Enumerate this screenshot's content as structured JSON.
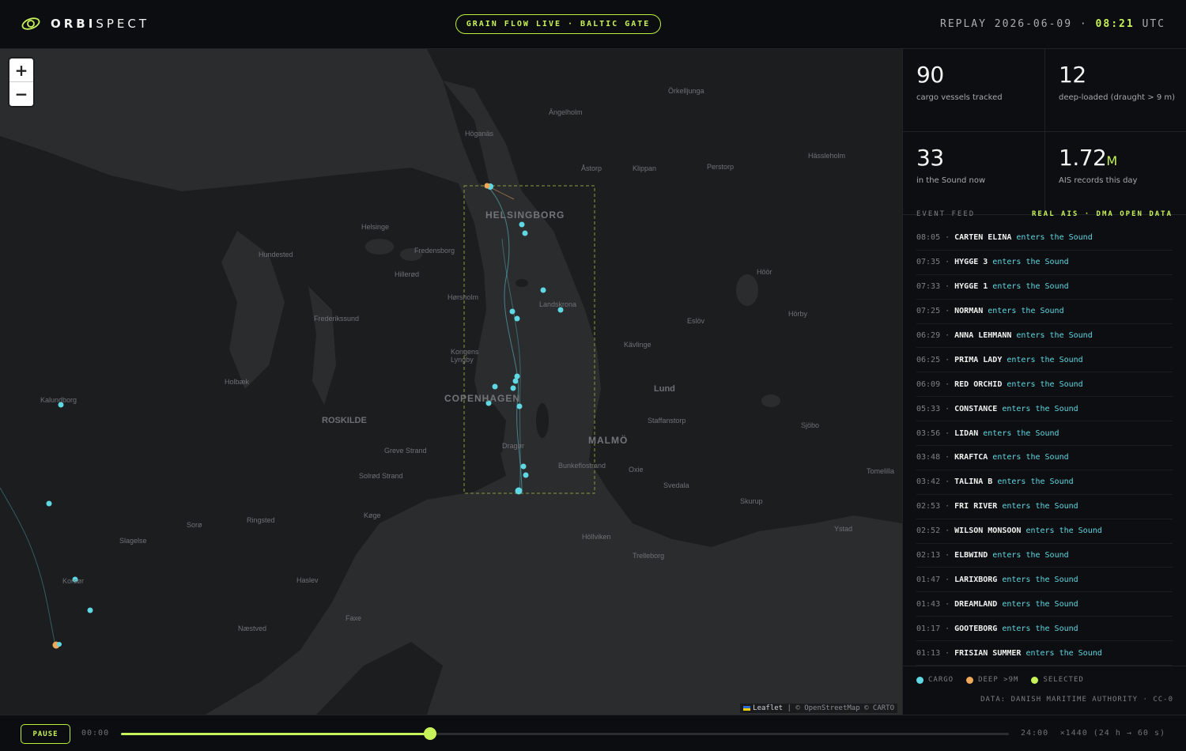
{
  "header": {
    "brand": "ORBISPECT",
    "brand_bold": "ORBI",
    "brand_light": "SPECT",
    "pill": "GRAIN FLOW LIVE · BALTIC GATE",
    "replay_prefix": "REPLAY 2026-06-09 ·",
    "replay_time": "08:21",
    "replay_suffix": "UTC"
  },
  "map": {
    "zoom_in": "+",
    "zoom_out": "−",
    "attribution_leaflet": "Leaflet",
    "attribution_rest": "| © OpenStreetMap © CARTO",
    "places": [
      {
        "name": "Örkelljunga",
        "style": "small"
      },
      {
        "name": "Ängelholm",
        "style": "small"
      },
      {
        "name": "Höganäs",
        "style": "small"
      },
      {
        "name": "Åstorp",
        "style": "small"
      },
      {
        "name": "Klippan",
        "style": "small"
      },
      {
        "name": "Perstorp",
        "style": "small"
      },
      {
        "name": "Hässleholm",
        "style": "small"
      },
      {
        "name": "HELSINGBORG",
        "style": "big"
      },
      {
        "name": "Helsinge",
        "style": "small"
      },
      {
        "name": "Hundested",
        "style": "small"
      },
      {
        "name": "Fredensborg",
        "style": "small"
      },
      {
        "name": "Hillerød",
        "style": "small"
      },
      {
        "name": "Hørsholm",
        "style": "small"
      },
      {
        "name": "Frederikssund",
        "style": "small"
      },
      {
        "name": "Landskrona",
        "style": "small"
      },
      {
        "name": "Höör",
        "style": "small"
      },
      {
        "name": "Hörby",
        "style": "small"
      },
      {
        "name": "Eslöv",
        "style": "small"
      },
      {
        "name": "Kävlinge",
        "style": "small"
      },
      {
        "name": "Kongens Lyngby",
        "style": "small"
      },
      {
        "name": "Holbæk",
        "style": "small"
      },
      {
        "name": "Lund",
        "style": "mid"
      },
      {
        "name": "Kalundborg",
        "style": "small"
      },
      {
        "name": "COPENHAGEN",
        "style": "big"
      },
      {
        "name": "ROSKILDE",
        "style": "mid"
      },
      {
        "name": "Staffanstorp",
        "style": "small"
      },
      {
        "name": "Sjöbo",
        "style": "small"
      },
      {
        "name": "MALMÖ",
        "style": "big"
      },
      {
        "name": "Greve Strand",
        "style": "small"
      },
      {
        "name": "Dragør",
        "style": "small"
      },
      {
        "name": "Solrød Strand",
        "style": "small"
      },
      {
        "name": "Bunkeflostrand",
        "style": "small"
      },
      {
        "name": "Oxie",
        "style": "small"
      },
      {
        "name": "Svedala",
        "style": "small"
      },
      {
        "name": "Tomelilla",
        "style": "small"
      },
      {
        "name": "Skurup",
        "style": "small"
      },
      {
        "name": "Køge",
        "style": "small"
      },
      {
        "name": "Sorø",
        "style": "small"
      },
      {
        "name": "Ringsted",
        "style": "small"
      },
      {
        "name": "Ystad",
        "style": "small"
      },
      {
        "name": "Slagelse",
        "style": "small"
      },
      {
        "name": "Höllviken",
        "style": "small"
      },
      {
        "name": "Trelleborg",
        "style": "small"
      },
      {
        "name": "Korsør",
        "style": "small"
      },
      {
        "name": "Haslev",
        "style": "small"
      },
      {
        "name": "Faxe",
        "style": "small"
      },
      {
        "name": "Næstved",
        "style": "small"
      }
    ]
  },
  "stats": [
    {
      "value": "90",
      "unit": "",
      "label": "cargo vessels tracked"
    },
    {
      "value": "12",
      "unit": "",
      "label": "deep-loaded (draught > 9 m)"
    },
    {
      "value": "33",
      "unit": "",
      "label": "in the Sound now"
    },
    {
      "value": "1.72",
      "unit": "M",
      "label": "AIS records this day"
    }
  ],
  "feed": {
    "title": "EVENT FEED",
    "source": "REAL AIS · DMA OPEN DATA",
    "events": [
      {
        "time": "08:05",
        "vessel": "CARTEN ELINA",
        "action": "enters the Sound"
      },
      {
        "time": "07:35",
        "vessel": "HYGGE 3",
        "action": "enters the Sound"
      },
      {
        "time": "07:33",
        "vessel": "HYGGE 1",
        "action": "enters the Sound"
      },
      {
        "time": "07:25",
        "vessel": "NORMAN",
        "action": "enters the Sound"
      },
      {
        "time": "06:29",
        "vessel": "ANNA LEHMANN",
        "action": "enters the Sound"
      },
      {
        "time": "06:25",
        "vessel": "PRIMA LADY",
        "action": "enters the Sound"
      },
      {
        "time": "06:09",
        "vessel": "RED ORCHID",
        "action": "enters the Sound"
      },
      {
        "time": "05:33",
        "vessel": "CONSTANCE",
        "action": "enters the Sound"
      },
      {
        "time": "03:56",
        "vessel": "LIDAN",
        "action": "enters the Sound"
      },
      {
        "time": "03:48",
        "vessel": "KRAFTCA",
        "action": "enters the Sound"
      },
      {
        "time": "03:42",
        "vessel": "TALINA B",
        "action": "enters the Sound"
      },
      {
        "time": "02:53",
        "vessel": "FRI RIVER",
        "action": "enters the Sound"
      },
      {
        "time": "02:52",
        "vessel": "WILSON MONSOON",
        "action": "enters the Sound"
      },
      {
        "time": "02:13",
        "vessel": "ELBWIND",
        "action": "enters the Sound"
      },
      {
        "time": "01:47",
        "vessel": "LARIXBORG",
        "action": "enters the Sound"
      },
      {
        "time": "01:43",
        "vessel": "DREAMLAND",
        "action": "enters the Sound"
      },
      {
        "time": "01:17",
        "vessel": "GOOTEBORG",
        "action": "enters the Sound"
      },
      {
        "time": "01:13",
        "vessel": "FRISIAN SUMMER",
        "action": "enters the Sound"
      }
    ]
  },
  "legend": {
    "cargo": "CARGO",
    "deep": "DEEP >9M",
    "selected": "SELECTED",
    "credit": "DATA: DANISH MARITIME AUTHORITY · CC-0"
  },
  "colors": {
    "accent": "#c7f25a",
    "cargo": "#5fd8e3",
    "deep": "#f0a95a",
    "selected": "#c7f25a"
  },
  "playback": {
    "button": "PAUSE",
    "start": "00:00",
    "end": "24:00",
    "speed": "×1440 (24 h → 60 s)",
    "progress": 0.348
  }
}
